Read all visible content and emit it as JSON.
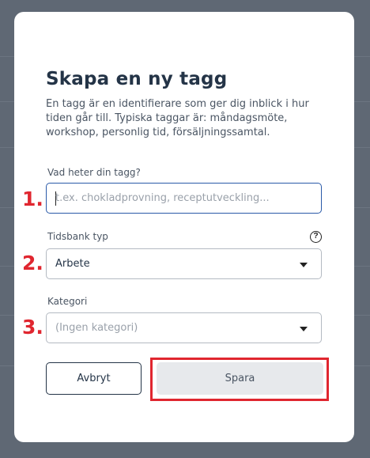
{
  "modal": {
    "title": "Skapa en ny tagg",
    "description": "En tagg är en identifierare som ger dig inblick i hur tiden går till. Typiska taggar är: måndagsmöte, workshop, personlig tid, försäljningssamtal."
  },
  "fields": {
    "tag_name": {
      "label": "Vad heter din tagg?",
      "placeholder": "t.ex. chokladprovning, receptutveckling...",
      "value": ""
    },
    "timebank_type": {
      "label": "Tidsbank typ",
      "value": "Arbete"
    },
    "category": {
      "label": "Kategori",
      "value": "(Ingen kategori)"
    }
  },
  "annotations": {
    "step1": "1.",
    "step2": "2.",
    "step3": "3."
  },
  "help_icon_glyph": "?",
  "buttons": {
    "cancel": "Avbryt",
    "save": "Spara"
  },
  "colors": {
    "overlay": "#5f6874",
    "title": "#243447",
    "annotation_red": "#e0262f",
    "focus_border": "#2a5aa8",
    "save_button_bg": "#e7e9ec"
  }
}
